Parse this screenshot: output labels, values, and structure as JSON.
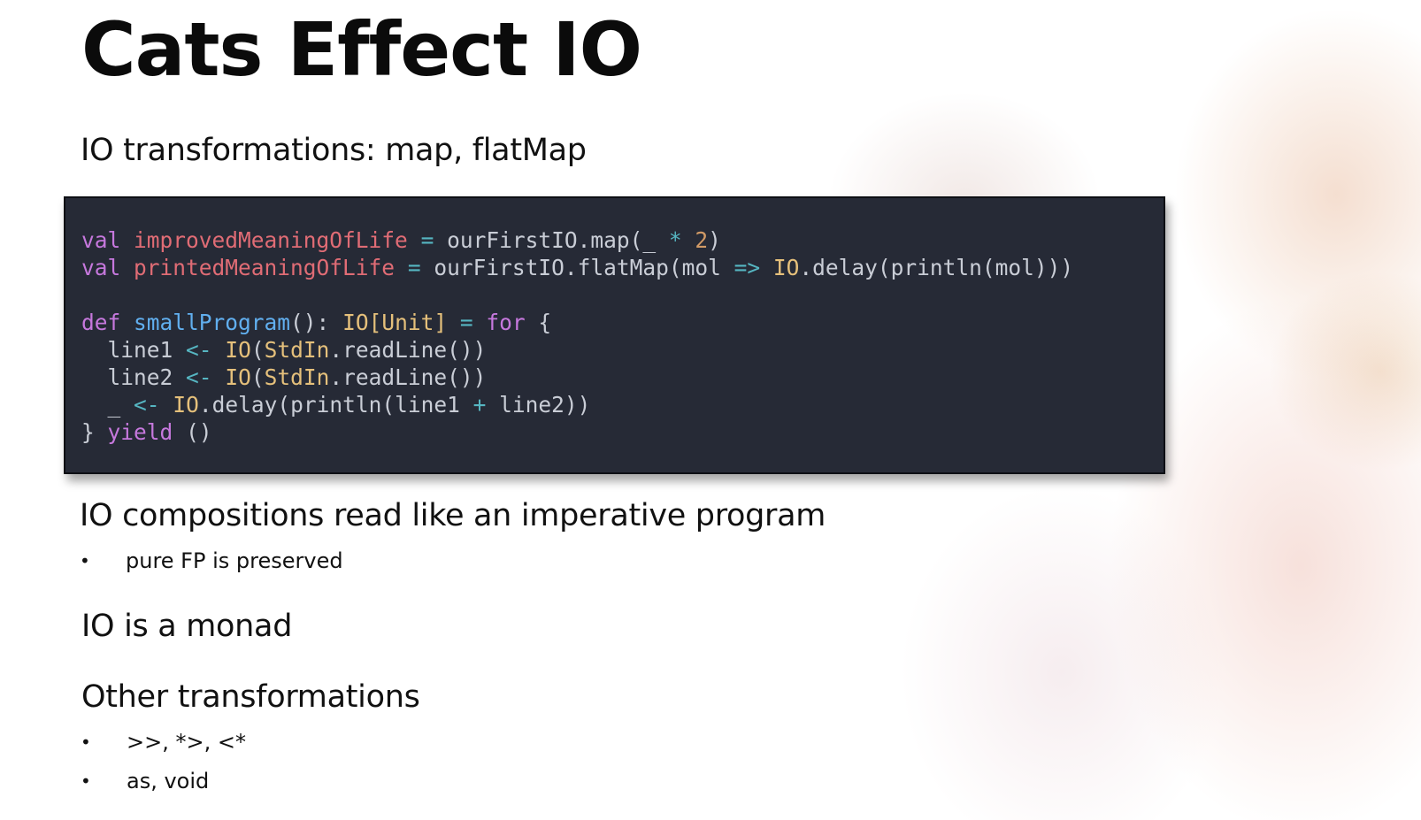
{
  "slide": {
    "title": "Cats Effect IO",
    "subtitle": "IO transformations: map, flatMap",
    "sections": [
      {
        "heading": "IO compositions read like an imperative program",
        "bullets": [
          "pure FP is preserved"
        ]
      },
      {
        "heading": "IO is a monad",
        "bullets": []
      },
      {
        "heading": "Other transformations",
        "bullets": [
          ">>, *>, <*",
          "as, void"
        ]
      }
    ],
    "bullet_glyph": "•"
  },
  "code": {
    "line1": [
      "val",
      "improvedMeaningOfLife",
      "=",
      "ourFirstIO.map(_",
      "*",
      "2",
      ")"
    ],
    "line2": [
      "val",
      "printedMeaningOfLife",
      "=",
      "ourFirstIO.flatMap(mol",
      "=>",
      "IO",
      ".delay(println(mol)))"
    ],
    "line4": [
      "def",
      "smallProgram",
      "():",
      "IO[Unit]",
      "=",
      "for",
      "{"
    ],
    "line5": [
      "  line1",
      "<-",
      "IO",
      "(",
      "StdIn",
      ".readLine())"
    ],
    "line6": [
      "  line2",
      "<-",
      "IO",
      "(",
      "StdIn",
      ".readLine())"
    ],
    "line7": [
      "  _",
      "<-",
      "IO",
      ".delay(println(line1",
      "+",
      "line2))"
    ],
    "line8": [
      "}",
      "yield",
      "()"
    ]
  },
  "colors": {
    "code_background": "#262a36",
    "keyword": "#c678dd",
    "variable": "#e06c75",
    "function": "#61afef",
    "type": "#e5c07b",
    "operator": "#56b6c2",
    "number": "#d19a66"
  }
}
